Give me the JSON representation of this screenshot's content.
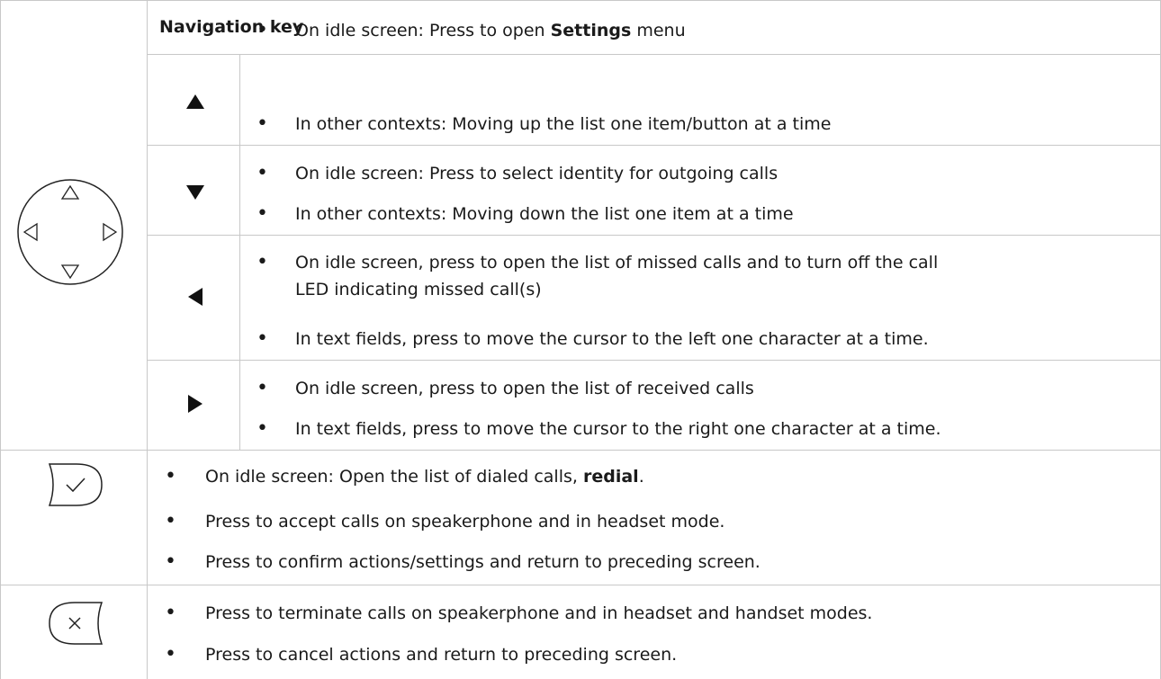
{
  "header": {
    "title": "Navigation key"
  },
  "nav_rows": [
    {
      "arrow": "up-arrow-icon",
      "items": [
        {
          "pre": "On idle screen:  Press to open ",
          "bold": "Settings",
          "post": " menu"
        },
        {
          "pre": "In other contexts:  Moving up the list one item/button at a time",
          "bold": "",
          "post": ""
        }
      ]
    },
    {
      "arrow": "down-arrow-icon",
      "items": [
        {
          "pre": "On idle screen:  Press to select identity for outgoing calls",
          "bold": "",
          "post": ""
        },
        {
          "pre": "In other contexts:  Moving down the list one item at a time",
          "bold": "",
          "post": ""
        }
      ]
    },
    {
      "arrow": "left-arrow-icon",
      "items": [
        {
          "line1": "On idle screen, press to open the list of missed calls and to turn off the call",
          "line2": "LED indicating missed call(s)"
        },
        {
          "pre": "In text fields, press to move the cursor to the left one character at a time.",
          "bold": "",
          "post": ""
        }
      ]
    },
    {
      "arrow": "right-arrow-icon",
      "items": [
        {
          "pre": "On idle screen, press to open the list of received  calls",
          "bold": "",
          "post": ""
        },
        {
          "pre": "In text fields, press to move the cursor to the right one character at a time.",
          "bold": "",
          "post": ""
        }
      ]
    }
  ],
  "accept_rows": [
    {
      "pre": "On idle screen:  Open the list of dialed calls, ",
      "bold": "redial",
      "post": "."
    },
    {
      "pre": "Press to accept calls on speakerphone and in headset mode.",
      "bold": "",
      "post": ""
    },
    {
      "pre": "Press to confirm actions/settings and return to preceding screen.",
      "bold": "",
      "post": ""
    }
  ],
  "cancel_rows": [
    {
      "pre": "Press to terminate calls on speakerphone and in headset and handset modes.",
      "bold": "",
      "post": ""
    },
    {
      "pre": "Press to cancel actions and return to preceding screen.",
      "bold": "",
      "post": ""
    }
  ],
  "bullet_char": "•",
  "colors": {
    "border": "#c8c8c8",
    "text": "#1a1a1a"
  }
}
